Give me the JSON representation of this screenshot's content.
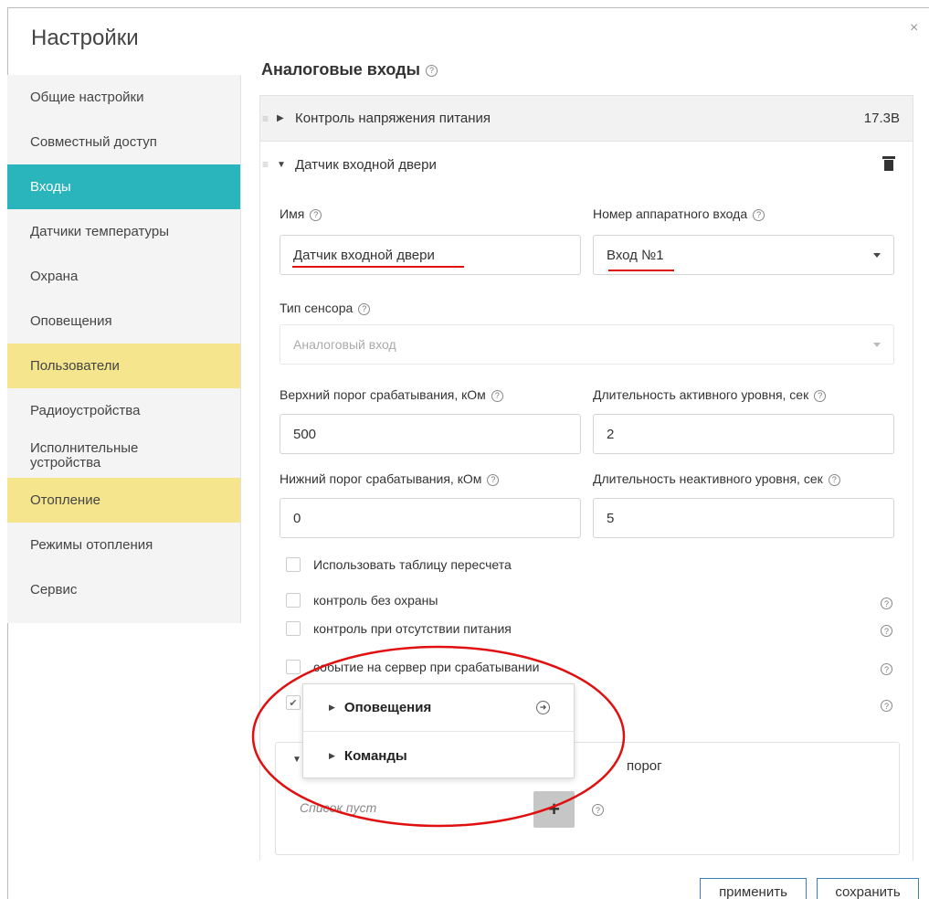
{
  "dialog": {
    "title": "Настройки",
    "close": "×"
  },
  "sidebar": {
    "items": [
      {
        "label": "Общие настройки"
      },
      {
        "label": "Совместный доступ"
      },
      {
        "label": "Входы"
      },
      {
        "label": "Датчики температуры"
      },
      {
        "label": "Охрана"
      },
      {
        "label": "Оповещения"
      },
      {
        "label": "Пользователи"
      },
      {
        "label": "Радиоустройства"
      },
      {
        "label": "Исполнительные устройства"
      },
      {
        "label": "Отопление"
      },
      {
        "label": "Режимы отопления"
      },
      {
        "label": "Сервис"
      }
    ],
    "active_color": "#29b5bb",
    "highlight_color": "#f5e68e"
  },
  "main": {
    "title": "Аналоговые входы",
    "help": "?",
    "rows": [
      {
        "label": "Контроль напряжения питания",
        "value": "17.3В"
      },
      {
        "label": "Датчик входной двери"
      }
    ]
  },
  "form": {
    "name_label": "Имя",
    "name_value": "Датчик входной двери",
    "hw_input_label": "Номер аппаратного входа",
    "hw_input_value": "Вход №1",
    "sensor_type_label": "Тип сенсора",
    "sensor_type_value": "Аналоговый вход",
    "upper_label": "Верхний порог срабатывания, кОм",
    "upper_value": "500",
    "active_dur_label": "Длительность активного уровня, сек",
    "active_dur_value": "2",
    "lower_label": "Нижний порог срабатывания, кОм",
    "lower_value": "0",
    "inactive_dur_label": "Длительность неактивного уровня, сек",
    "inactive_dur_value": "5"
  },
  "checkboxes": [
    {
      "label": "Использовать таблицу пересчета"
    },
    {
      "label": "контроль без охраны"
    },
    {
      "label": "контроль при отсутствии питания"
    },
    {
      "label": "событие на сервер при срабатывании"
    },
    {
      "label": ""
    }
  ],
  "subpanel": {
    "title": "порог",
    "empty_text": "Список пуст",
    "add": "+"
  },
  "popup": {
    "items": [
      {
        "label": "Оповещения",
        "icon": "arrow-circle-icon"
      },
      {
        "label": "Команды"
      }
    ]
  },
  "buttons": {
    "apply": "применить",
    "save": "сохранить"
  },
  "colors": {
    "annotation_red": "#e01010",
    "button_border": "#3a7ec0"
  }
}
